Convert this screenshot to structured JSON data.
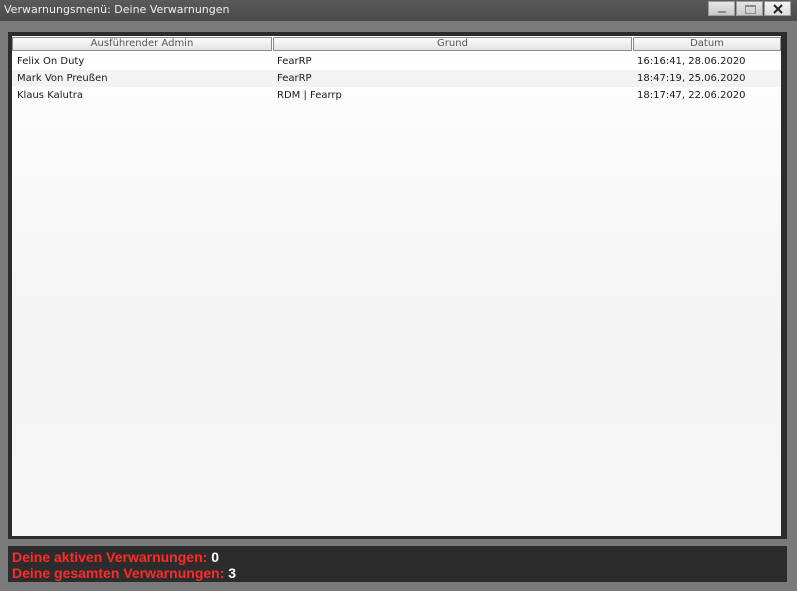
{
  "window": {
    "title": "Verwarnungsmenü: Deine Verwarnungen"
  },
  "table": {
    "columns": [
      "Ausführender Admin",
      "Grund",
      "Datum"
    ],
    "rows": [
      {
        "admin": "Felix On Duty",
        "reason": "FearRP",
        "date": "16:16:41, 28.06.2020"
      },
      {
        "admin": "Mark Von Preußen",
        "reason": "FearRP",
        "date": "18:47:19, 25.06.2020"
      },
      {
        "admin": "Klaus Kalutra",
        "reason": "RDM | Fearrp",
        "date": "18:17:47, 22.06.2020"
      }
    ]
  },
  "summary": {
    "active_label": "Deine aktiven Verwarnungen:",
    "active_count": "0",
    "total_label": "Deine gesamten Verwarnungen:",
    "total_count": "3"
  },
  "colors": {
    "label_red": "#ff2a2a",
    "value_white": "#ffffff"
  }
}
